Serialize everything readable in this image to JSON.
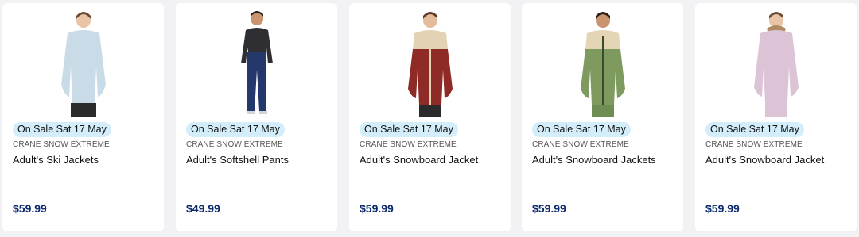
{
  "products": [
    {
      "image_alt": "Woman wearing light blue ski jacket",
      "badge": "On Sale Sat 17 May",
      "brand": "CRANE SNOW EXTREME",
      "name": "Adult's Ski Jackets",
      "price": "$59.99",
      "colors": {
        "primary": "#c9dbe6",
        "secondary": "#c9dbe6",
        "lower": "#2b2b2b"
      }
    },
    {
      "image_alt": "Man wearing navy softshell pants",
      "badge": "On Sale Sat 17 May",
      "brand": "CRANE SNOW EXTREME",
      "name": "Adult's Softshell Pants",
      "price": "$49.99",
      "colors": {
        "primary": "#2f2f33",
        "secondary": "#2f2f33",
        "lower": "#24386b"
      }
    },
    {
      "image_alt": "Woman wearing burgundy and beige snowboard jacket",
      "badge": "On Sale Sat 17 May",
      "brand": "CRANE SNOW EXTREME",
      "name": "Adult's Snowboard Jacket",
      "price": "$59.99",
      "colors": {
        "primary": "#8e2b26",
        "secondary": "#e3d2b4",
        "lower": "#2b2b2b"
      }
    },
    {
      "image_alt": "Man wearing green and beige snowboard jacket",
      "badge": "On Sale Sat 17 May",
      "brand": "CRANE SNOW EXTREME",
      "name": "Adult's Snowboard Jackets",
      "price": "$59.99",
      "colors": {
        "primary": "#7e9a5e",
        "secondary": "#e3d5b5",
        "lower": "#6f8d52"
      }
    },
    {
      "image_alt": "Woman wearing light pink snowboard jacket",
      "badge": "On Sale Sat 17 May",
      "brand": "CRANE SNOW EXTREME",
      "name": "Adult's Snowboard Jacket",
      "price": "$59.99",
      "colors": {
        "primary": "#dcc3d6",
        "secondary": "#dcc3d6",
        "lower": "#dcc3d6"
      }
    }
  ]
}
